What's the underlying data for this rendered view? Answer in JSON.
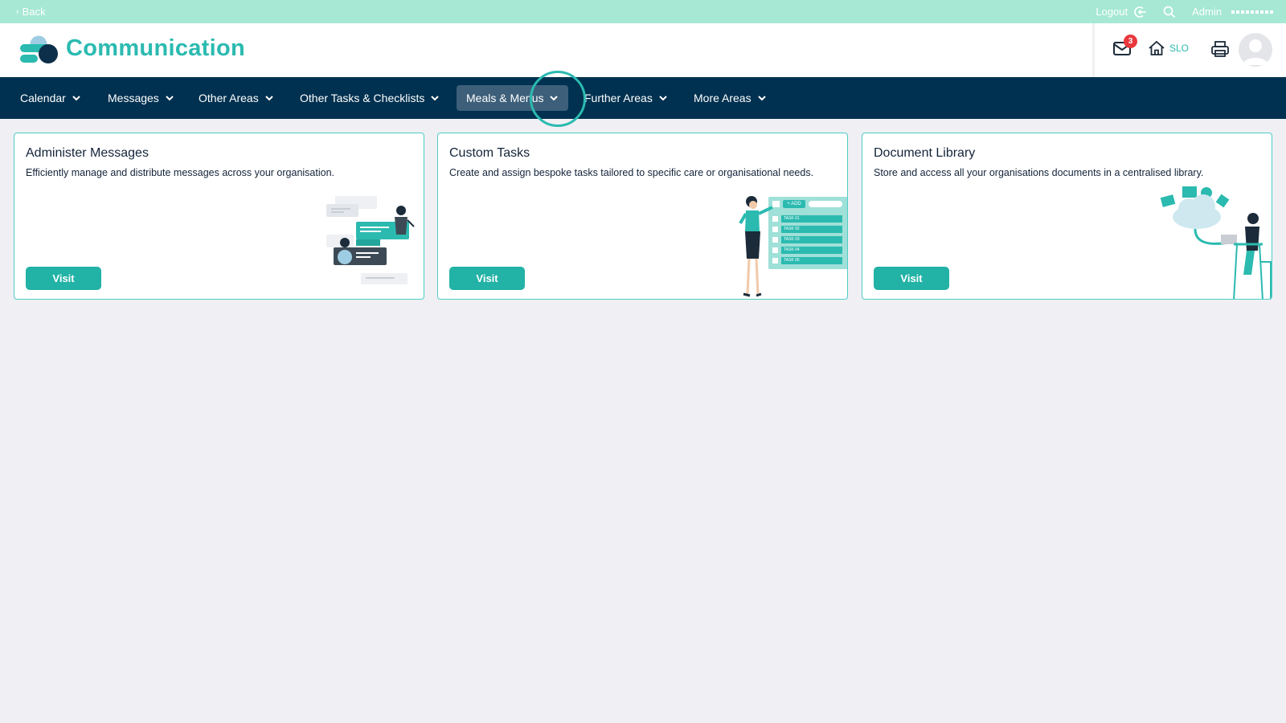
{
  "topbar": {
    "back_label": "Back",
    "logout_label": "Logout",
    "user_label": "Admin"
  },
  "header": {
    "title": "Communication",
    "mail_count": "3",
    "home_label": "SLO"
  },
  "nav": {
    "items": [
      {
        "label": "Calendar"
      },
      {
        "label": "Messages"
      },
      {
        "label": "Other Areas"
      },
      {
        "label": "Other Tasks & Checklists"
      },
      {
        "label": "Meals & Menus",
        "active": true
      },
      {
        "label": "Further Areas"
      },
      {
        "label": "More Areas"
      }
    ]
  },
  "cards": [
    {
      "title": "Administer Messages",
      "description": "Efficiently manage and distribute messages across your organisation.",
      "button_label": "Visit",
      "illustration": "messaging-people-illustration"
    },
    {
      "title": "Custom Tasks",
      "description": "Create and assign bespoke tasks tailored to specific care or organisational needs.",
      "button_label": "Visit",
      "illustration": "task-board-woman-illustration",
      "board_button": "+ ADD",
      "board_rows": [
        "TASK 01",
        "TASK 02",
        "TASK 03",
        "TASK 04",
        "TASK 05"
      ]
    },
    {
      "title": "Document Library",
      "description": "Store and access all your organisations documents in a centralised library.",
      "button_label": "Visit",
      "illustration": "cloud-library-man-illustration"
    }
  ],
  "colors": {
    "accent": "#2bbab0",
    "topbar": "#a6e8d3",
    "navbar": "#003150",
    "badge": "#e8383d"
  }
}
